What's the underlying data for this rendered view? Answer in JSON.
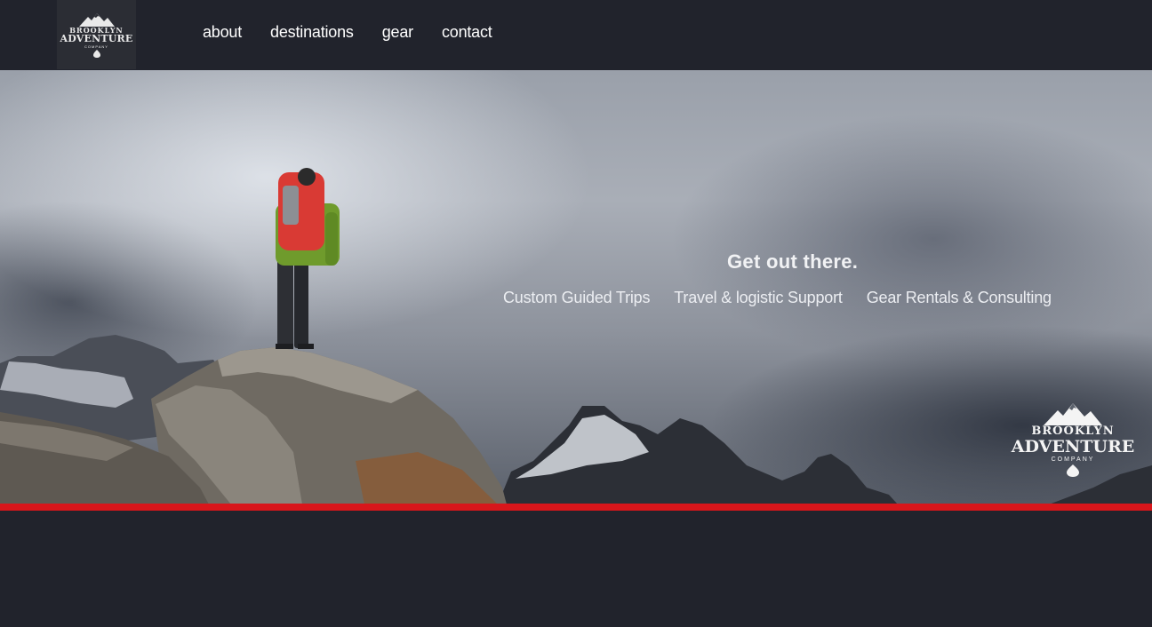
{
  "brand": {
    "line1": "BROOKLYN",
    "line2": "ADVENTURE",
    "line3": "COMPANY",
    "icon": "mountain-logo-icon"
  },
  "nav": {
    "items": [
      {
        "label": "about"
      },
      {
        "label": "destinations"
      },
      {
        "label": "gear"
      },
      {
        "label": "contact"
      }
    ]
  },
  "hero": {
    "tagline": "Get out there.",
    "services": [
      "Custom Guided Trips",
      "Travel & logistic Support",
      "Gear Rentals & Consulting"
    ]
  },
  "colors": {
    "background": "#21232c",
    "accent_stripe": "#d8161b",
    "text": "#ffffff"
  }
}
